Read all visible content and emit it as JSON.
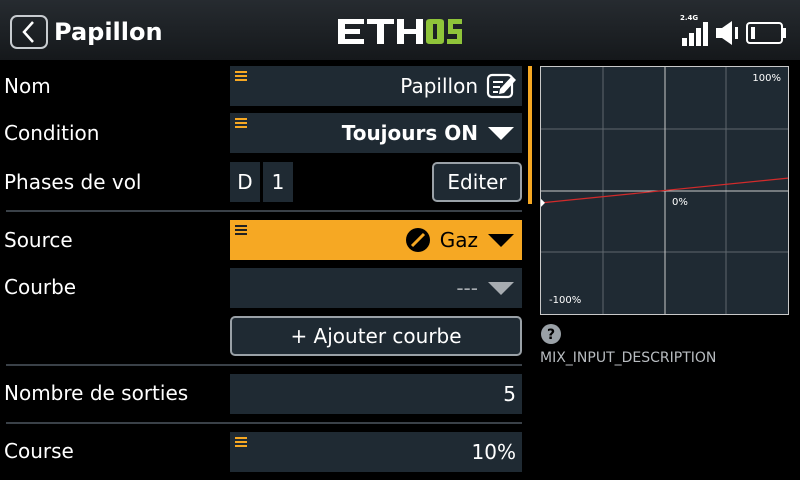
{
  "header": {
    "title": "Papillon",
    "logo": "ETHOS",
    "radio_band": "2.4G",
    "colors": {
      "logo_left": "#ffffff",
      "logo_right": "#8fc43a",
      "header_bg": "#20252a"
    }
  },
  "form": {
    "name": {
      "label": "Nom",
      "value": "Papillon",
      "icon": "edit-icon"
    },
    "condition": {
      "label": "Condition",
      "value": "Toujours ON"
    },
    "flight_phases": {
      "label": "Phases de vol",
      "chip_d": "D",
      "chip_1": "1",
      "edit_label": "Editer"
    },
    "source": {
      "label": "Source",
      "value": "Gaz",
      "icon": "throttle-icon"
    },
    "curve": {
      "label": "Courbe",
      "value": "---"
    },
    "add_curve": {
      "label": "+ Ajouter courbe"
    },
    "outputs": {
      "label": "Nombre de sorties",
      "value": "5"
    },
    "travel": {
      "label": "Course",
      "value": "10%"
    }
  },
  "graph": {
    "top_label": "100%",
    "mid_label": "0%",
    "bottom_label": "-100%",
    "line_color": "#d22b2b",
    "output_at_min_input_pct": -10,
    "output_at_max_input_pct": 10
  },
  "help": {
    "icon": "help-icon",
    "description": "MIX_INPUT_DESCRIPTION"
  },
  "colors": {
    "accent": "#f6a823",
    "field_bg": "#1f2a33"
  }
}
